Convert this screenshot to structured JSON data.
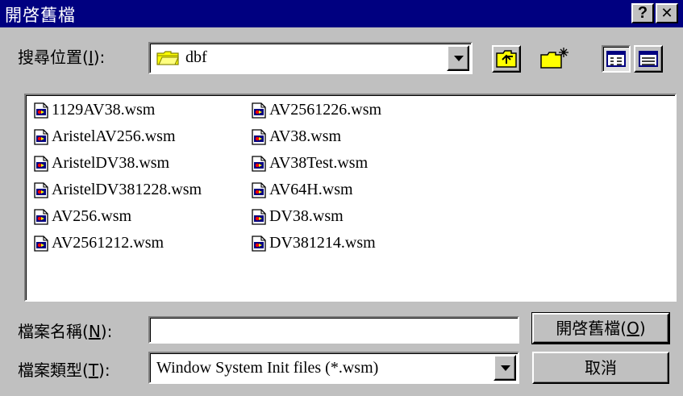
{
  "window": {
    "title": "開啓舊檔",
    "help_button": "?",
    "close_button": "✕"
  },
  "look_in": {
    "label_main": "搜尋位置(",
    "label_key": "I",
    "label_end": "):",
    "value": "dbf"
  },
  "toolbar": {
    "up_folder": "up-one-level",
    "new_folder": "create-new-folder",
    "list_view": "list",
    "details_view": "details"
  },
  "files": {
    "column1": [
      "1129AV38.wsm",
      "AristelAV256.wsm",
      "AristelDV38.wsm",
      "AristelDV381228.wsm",
      "AV256.wsm",
      "AV2561212.wsm"
    ],
    "column2": [
      "AV2561226.wsm",
      "AV38.wsm",
      "AV38Test.wsm",
      "AV64H.wsm",
      "DV38.wsm",
      "DV381214.wsm"
    ]
  },
  "file_name": {
    "label_main": "檔案名稱(",
    "label_key": "N",
    "label_end": "):",
    "value": ""
  },
  "file_type": {
    "label_main": "檔案類型(",
    "label_key": "T",
    "label_end": "):",
    "value": "Window System Init files (*.wsm)"
  },
  "buttons": {
    "open_main": "開啓舊檔(",
    "open_key": "O",
    "open_end": ")",
    "cancel": "取消"
  },
  "colors": {
    "title_bar": "#000080",
    "face": "#c0c0c0",
    "folder": "#ffff00"
  }
}
